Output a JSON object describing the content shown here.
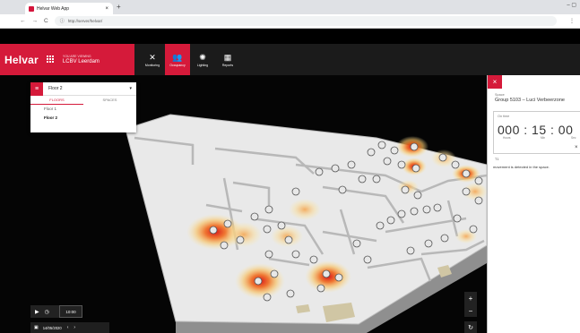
{
  "browser": {
    "tab_title": "Helvar Web App",
    "tab_close": "×",
    "new_tab": "+",
    "window_controls": "–  ▢",
    "url": "http://server/helvar/",
    "nav_back": "←",
    "nav_forward": "→",
    "nav_reload": "C"
  },
  "header": {
    "brand": "Helvar",
    "viewing_label": "YOU ARE VIEWING",
    "site_name": "LCBV Leerdam",
    "nav": [
      {
        "label": "Monitoring",
        "icon": "wrench-cross-icon"
      },
      {
        "label": "Occupancy",
        "icon": "people-icon"
      },
      {
        "label": "Lighting",
        "icon": "lightbulb-icon"
      },
      {
        "label": "Reports",
        "icon": "reports-icon"
      }
    ]
  },
  "floor_selector": {
    "current": "Floor 2",
    "tabs": [
      "FLOORS",
      "SPACES"
    ],
    "items": [
      "Floor 1",
      "Floor 2"
    ]
  },
  "playback": {
    "time": "10:00",
    "date": "14/05/2020"
  },
  "panel": {
    "close": "×",
    "type_label": "Space",
    "name": "Group 5103 – Luci Verbeerzone",
    "on_time_label": "On time",
    "on_time": {
      "hours": "000",
      "minutes": "15",
      "seconds": "00"
    },
    "units": {
      "hours": "Hours",
      "minutes": "Min",
      "seconds": "Sec"
    },
    "clear": "×",
    "short_label": "T1",
    "description": "movement is detected in the space."
  },
  "colors": {
    "brand_red": "#d51a3a",
    "header_dark": "#1b1b1b",
    "heat_core": "#e0201c",
    "heat_mid": "#f6a23a",
    "heat_outer": "#fbe9a8"
  }
}
